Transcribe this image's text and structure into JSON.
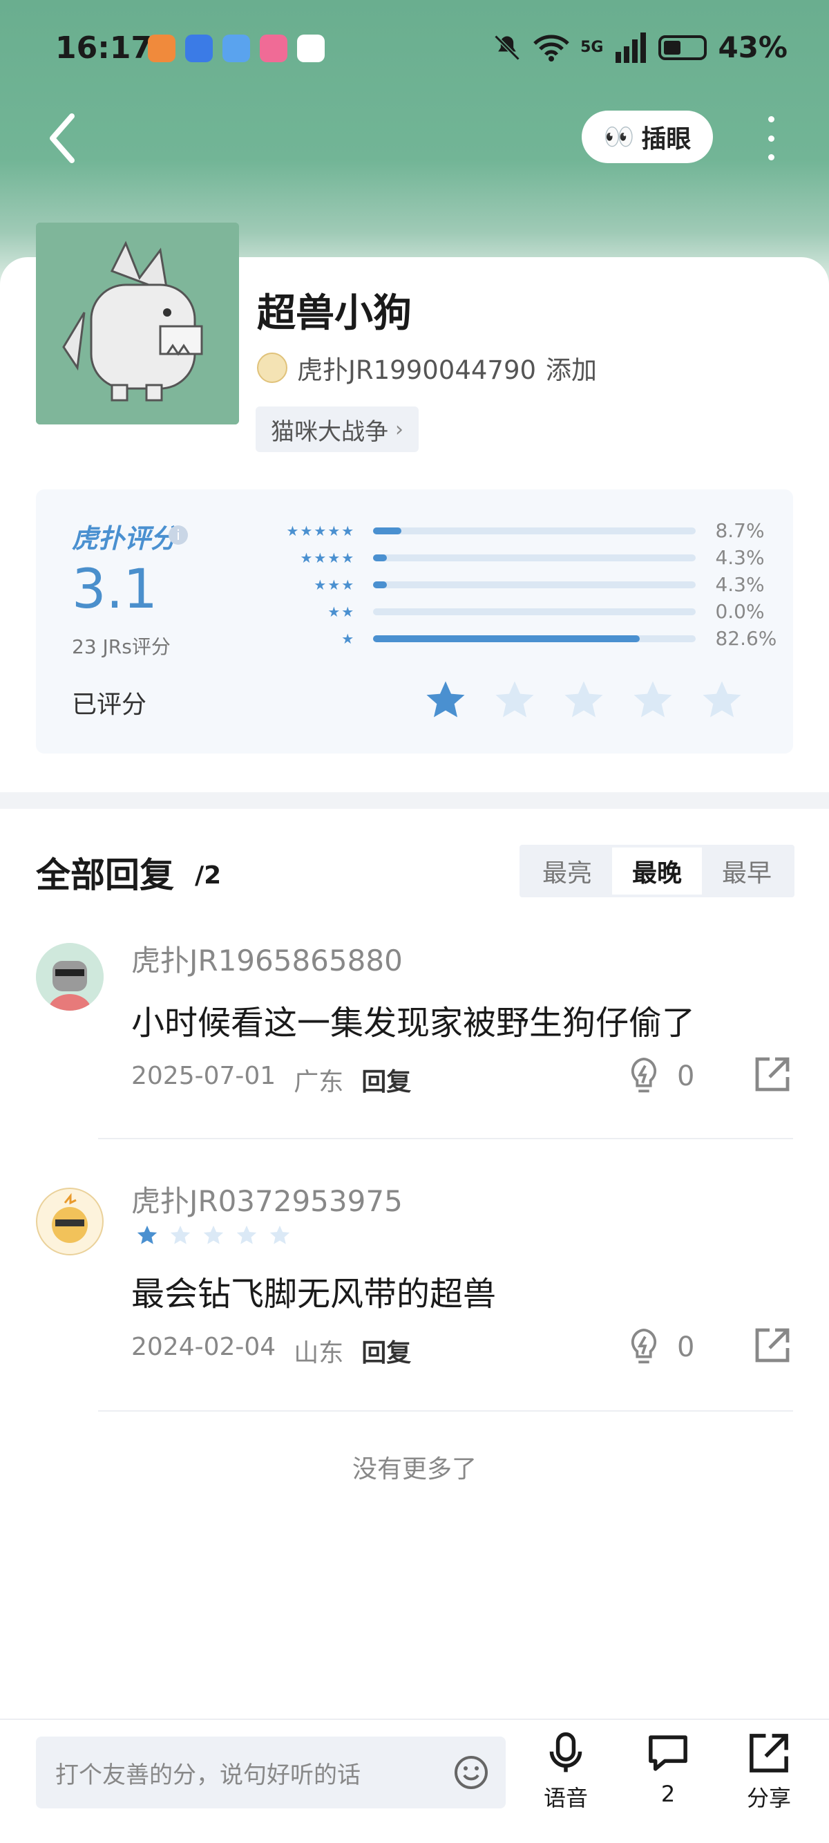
{
  "status_bar": {
    "time": "16:17",
    "network": "5G",
    "battery": "43%"
  },
  "header": {
    "peek_label": "插眼",
    "peek_emoji": "👀"
  },
  "item": {
    "title": "超兽小狗",
    "author": "虎扑JR1990044790",
    "author_action": "添加",
    "tag": "猫咪大战争"
  },
  "rating": {
    "logo": "虎扑评分",
    "score": "3.1",
    "count_label": "23 JRs评分",
    "rated_label": "已评分",
    "my_rating": 1,
    "distribution": [
      {
        "stars": "★★★★★",
        "pct_label": "8.7%",
        "pct": 8.7
      },
      {
        "stars": "★★★★",
        "pct_label": "4.3%",
        "pct": 4.3
      },
      {
        "stars": "★★★",
        "pct_label": "4.3%",
        "pct": 4.3
      },
      {
        "stars": "★★",
        "pct_label": "0.0%",
        "pct": 0.0
      },
      {
        "stars": "★",
        "pct_label": "82.6%",
        "pct": 82.6
      }
    ],
    "colors": {
      "accent": "#4a90d0",
      "star_off": "#dbe9f6"
    }
  },
  "replies": {
    "title": "全部回复",
    "count": "/2",
    "sort_options": [
      "最亮",
      "最晚",
      "最早"
    ],
    "sort_active": "最晚",
    "items": [
      {
        "user": "虎扑JR1965865880",
        "text": "小时候看这一集发现家被野生狗仔偷了",
        "date": "2025-07-01",
        "region": "广东",
        "reply_label": "回复",
        "likes": "0"
      },
      {
        "user": "虎扑JR0372953975",
        "text": "最会钻飞脚无风带的超兽",
        "date": "2024-02-04",
        "region": "山东",
        "reply_label": "回复",
        "likes": "0",
        "rating": 1
      }
    ],
    "no_more": "没有更多了"
  },
  "bottom_bar": {
    "input_placeholder": "打个友善的分，说句好听的话",
    "voice_label": "语音",
    "comment_count": "2",
    "share_label": "分享"
  }
}
